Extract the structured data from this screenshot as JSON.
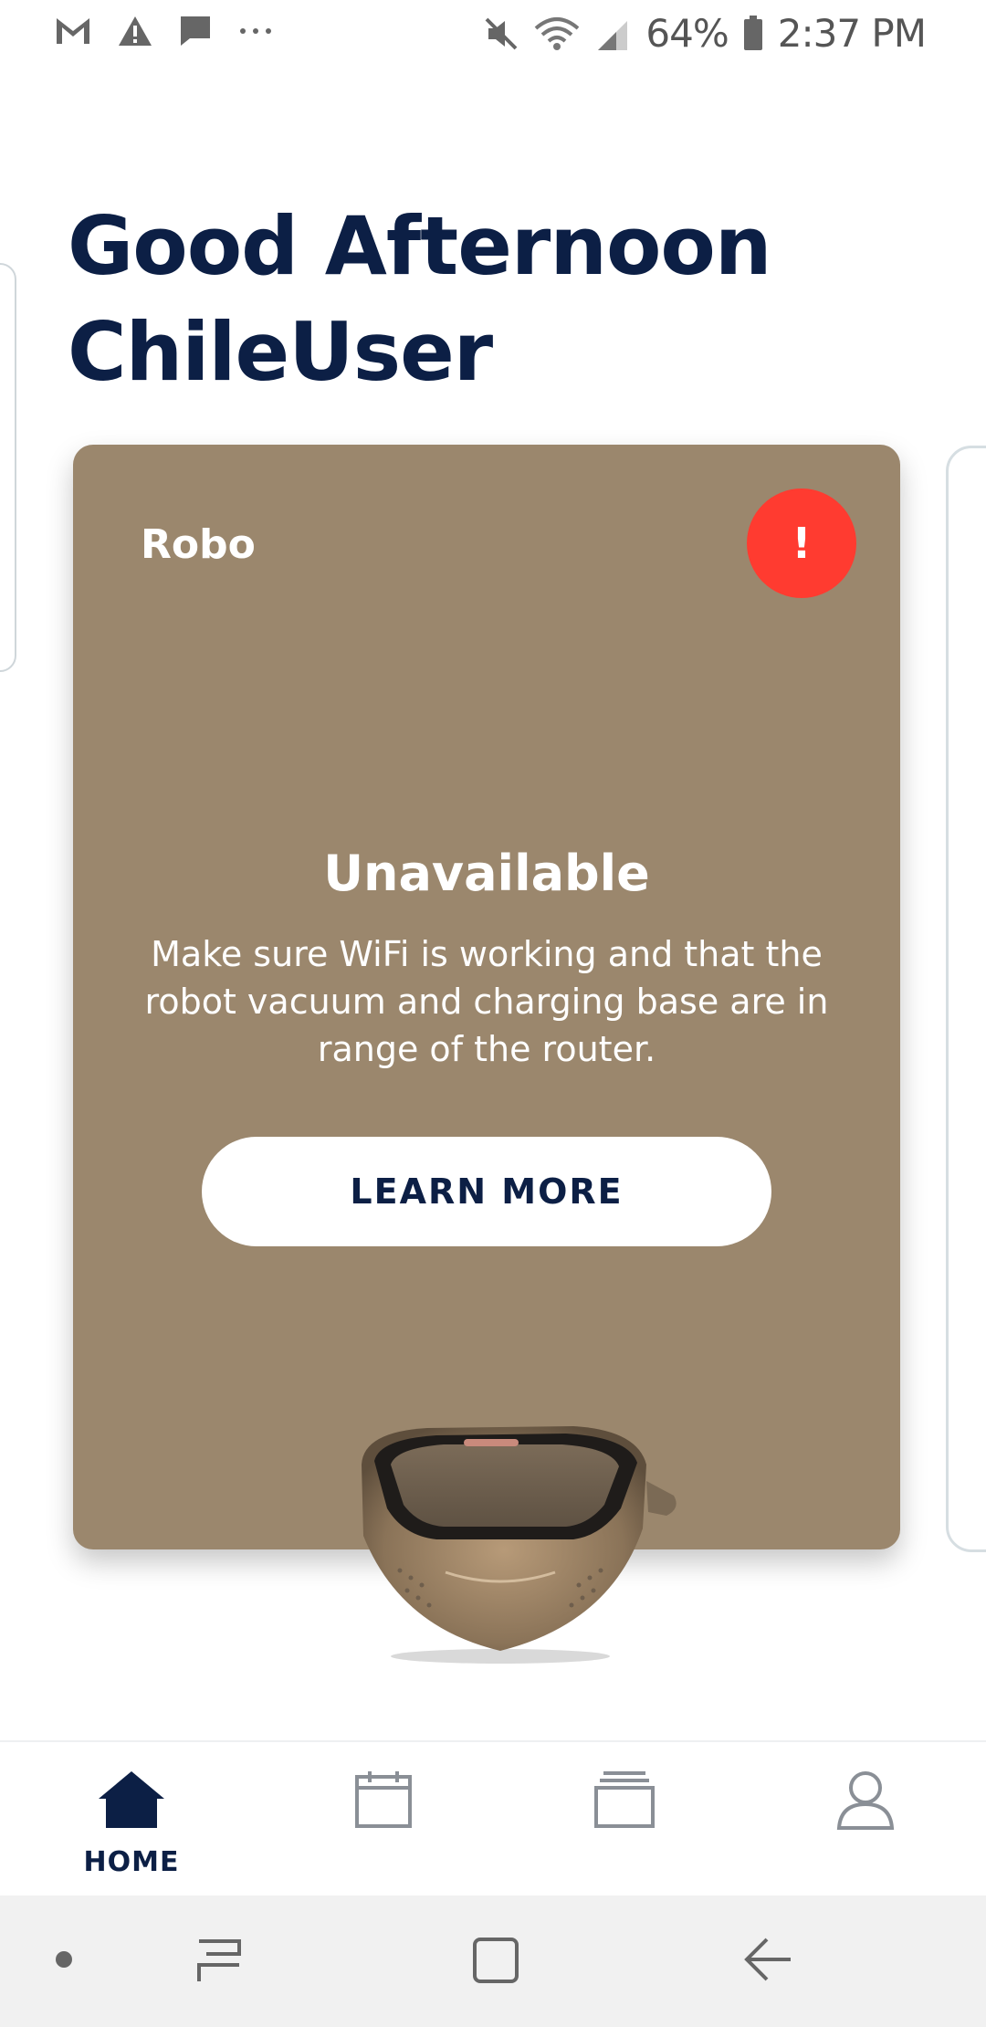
{
  "status_bar": {
    "battery": "64%",
    "time": "2:37 PM"
  },
  "greeting": {
    "line1": "Good Afternoon",
    "line2": "ChileUser"
  },
  "device_card": {
    "name": "Robo",
    "alert_symbol": "!",
    "status_title": "Unavailable",
    "status_message": "Make sure WiFi is working and that the robot vacuum and charging base are in range of the router.",
    "learn_more_label": "LEARN MORE",
    "background_color": "#9b876d",
    "alert_color": "#ff3b30"
  },
  "bottom_nav": {
    "items": [
      {
        "icon": "home-icon",
        "label": "HOME",
        "active": true
      },
      {
        "icon": "calendar-icon",
        "label": "",
        "active": false
      },
      {
        "icon": "history-icon",
        "label": "",
        "active": false
      },
      {
        "icon": "profile-icon",
        "label": "",
        "active": false
      }
    ]
  },
  "colors": {
    "primary_navy": "#0c1f45",
    "icon_gray": "#8a8f96"
  }
}
